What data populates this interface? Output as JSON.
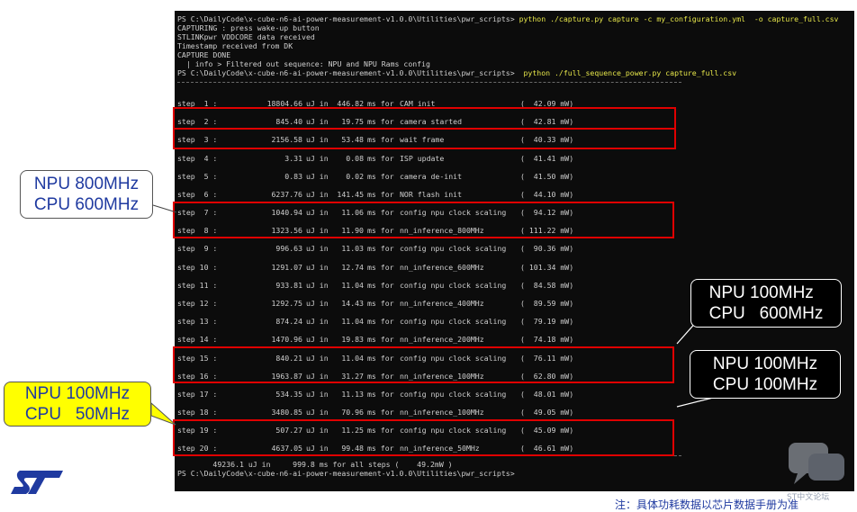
{
  "terminal": {
    "lines": [
      {
        "prompt": "PS C:\\DailyCode\\x-cube-n6-ai-power-measurement-v1.0.0\\Utilities\\pwr_scripts> ",
        "command": "python ./capture.py capture -c my_configuration.yml  -o capture_full.csv"
      },
      {
        "text": "CAPTURING : press wake-up button"
      },
      {
        "text": "STLINKpwr VDDCORE data received"
      },
      {
        "text": "Timestamp received from DK"
      },
      {
        "text": "CAPTURE DONE"
      },
      {
        "text": "  | info > Filtered out sequence: NPU and NPU Rams config"
      },
      {
        "prompt": "PS C:\\DailyCode\\x-cube-n6-ai-power-measurement-v1.0.0\\Utilities\\pwr_scripts> ",
        "command": " python ./full_sequence_power.py capture_full.csv"
      }
    ],
    "steps": [
      {
        "step": "step  1 :",
        "uj": "18804.66",
        "ms": "446.82",
        "desc": "CAM init",
        "mw": "(  42.09 mW)"
      },
      {
        "step": "step  2 :",
        "uj": "845.40",
        "ms": "19.75",
        "desc": "camera started",
        "mw": "(  42.81 mW)"
      },
      {
        "step": "step  3 :",
        "uj": "2156.58",
        "ms": "53.48",
        "desc": "wait frame",
        "mw": "(  40.33 mW)"
      },
      {
        "step": "step  4 :",
        "uj": "3.31",
        "ms": "0.08",
        "desc": "ISP update",
        "mw": "(  41.41 mW)"
      },
      {
        "step": "step  5 :",
        "uj": "0.83",
        "ms": "0.02",
        "desc": "camera de-init",
        "mw": "(  41.50 mW)"
      },
      {
        "step": "step  6 :",
        "uj": "6237.76",
        "ms": "141.45",
        "desc": "NOR flash init",
        "mw": "(  44.10 mW)"
      },
      {
        "step": "step  7 :",
        "uj": "1040.94",
        "ms": "11.06",
        "desc": "config npu clock scaling",
        "mw": "(  94.12 mW)"
      },
      {
        "step": "step  8 :",
        "uj": "1323.56",
        "ms": "11.90",
        "desc": "nn_inference_800MHz",
        "mw": "( 111.22 mW)"
      },
      {
        "step": "step  9 :",
        "uj": "996.63",
        "ms": "11.03",
        "desc": "config npu clock scaling",
        "mw": "(  90.36 mW)"
      },
      {
        "step": "step 10 :",
        "uj": "1291.07",
        "ms": "12.74",
        "desc": "nn_inference_600MHz",
        "mw": "( 101.34 mW)"
      },
      {
        "step": "step 11 :",
        "uj": "933.81",
        "ms": "11.04",
        "desc": "config npu clock scaling",
        "mw": "(  84.58 mW)"
      },
      {
        "step": "step 12 :",
        "uj": "1292.75",
        "ms": "14.43",
        "desc": "nn_inference_400MHz",
        "mw": "(  89.59 mW)"
      },
      {
        "step": "step 13 :",
        "uj": "874.24",
        "ms": "11.04",
        "desc": "config npu clock scaling",
        "mw": "(  79.19 mW)"
      },
      {
        "step": "step 14 :",
        "uj": "1470.96",
        "ms": "19.83",
        "desc": "nn_inference_200MHz",
        "mw": "(  74.18 mW)"
      },
      {
        "step": "step 15 :",
        "uj": "840.21",
        "ms": "11.04",
        "desc": "config npu clock scaling",
        "mw": "(  76.11 mW)"
      },
      {
        "step": "step 16 :",
        "uj": "1963.87",
        "ms": "31.27",
        "desc": "nn_inference_100MHz",
        "mw": "(  62.80 mW)"
      },
      {
        "step": "step 17 :",
        "uj": "534.35",
        "ms": "11.13",
        "desc": "config npu clock scaling",
        "mw": "(  48.01 mW)"
      },
      {
        "step": "step 18 :",
        "uj": "3480.85",
        "ms": "70.96",
        "desc": "nn_inference_100MHz",
        "mw": "(  49.05 mW)"
      },
      {
        "step": "step 19 :",
        "uj": "507.27",
        "ms": "11.25",
        "desc": "config npu clock scaling",
        "mw": "(  45.09 mW)"
      },
      {
        "step": "step 20 :",
        "uj": "4637.05",
        "ms": "99.48",
        "desc": "nn_inference_50MHz",
        "mw": "(  46.61 mW)"
      }
    ],
    "uj_unit": "uJ in",
    "ms_unit": "ms for",
    "total": "        49236.1 uJ in     999.8 ms for all steps (    49.2mW )",
    "final_prompt": "PS C:\\DailyCode\\x-cube-n6-ai-power-measurement-v1.0.0\\Utilities\\pwr_scripts>"
  },
  "callouts": {
    "npu800": "NPU 800MHz\nCPU 600MHz",
    "npu100_cpu600": "NPU 100MHz\nCPU   600MHz",
    "npu100_cpu100": "NPU 100MHz\nCPU 100MHz",
    "npu100_cpu50": "NPU 100MHz\nCPU   50MHz"
  },
  "footnote": "注：具体功耗数据以芯片数据手册为准",
  "watermark": "ST中文论坛",
  "logo": {
    "name": "st-logo",
    "color": "#1f3aa0"
  },
  "colors": {
    "highlight": "#e00000",
    "callout_text": "#1f3aa0",
    "yellow": "#ffff00",
    "command": "#e6e64a"
  }
}
